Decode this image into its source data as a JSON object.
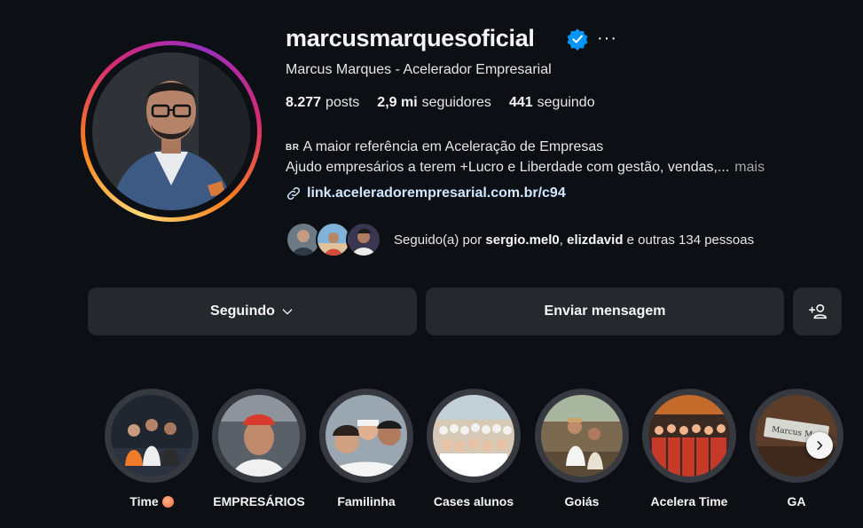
{
  "profile": {
    "username": "marcusmarquesoficial",
    "more": "···",
    "full_name": "Marcus Marques - Acelerador Empresarial",
    "stats": {
      "posts_count": "8.277",
      "posts_label": "posts",
      "followers_count": "2,9 mi",
      "followers_label": "seguidores",
      "following_count": "441",
      "following_label": "seguindo"
    },
    "bio": {
      "flag": "BR",
      "line1": "A maior referência em Aceleração de Empresas",
      "line2": "Ajudo empresários a terem +Lucro e Liberdade com gestão, vendas,...",
      "more": "mais"
    },
    "link": "link.aceleradorempresarial.com.br/c94",
    "followed_by": {
      "prefix": "Seguido(a) por",
      "user1": "sergio.mel0",
      "sep": ",",
      "user2": "elizdavid",
      "suffix": "e outras 134 pessoas"
    }
  },
  "actions": {
    "following": "Seguindo",
    "message": "Enviar mensagem"
  },
  "highlights": [
    {
      "label": "Time",
      "dot": true
    },
    {
      "label": "EMPRESÁRIOS"
    },
    {
      "label": "Familinha"
    },
    {
      "label": "Cases alunos"
    },
    {
      "label": "Goiás"
    },
    {
      "label": "Acelera Time"
    },
    {
      "label": "GA"
    }
  ],
  "highlight_7_plaque": "Marcus Marques",
  "colors": {
    "background": "#0c1014",
    "button": "#25292e",
    "verified": "#0095f6",
    "ring_gradient": [
      "#feda75",
      "#fa7e1e",
      "#d62976",
      "#962fbf"
    ]
  }
}
